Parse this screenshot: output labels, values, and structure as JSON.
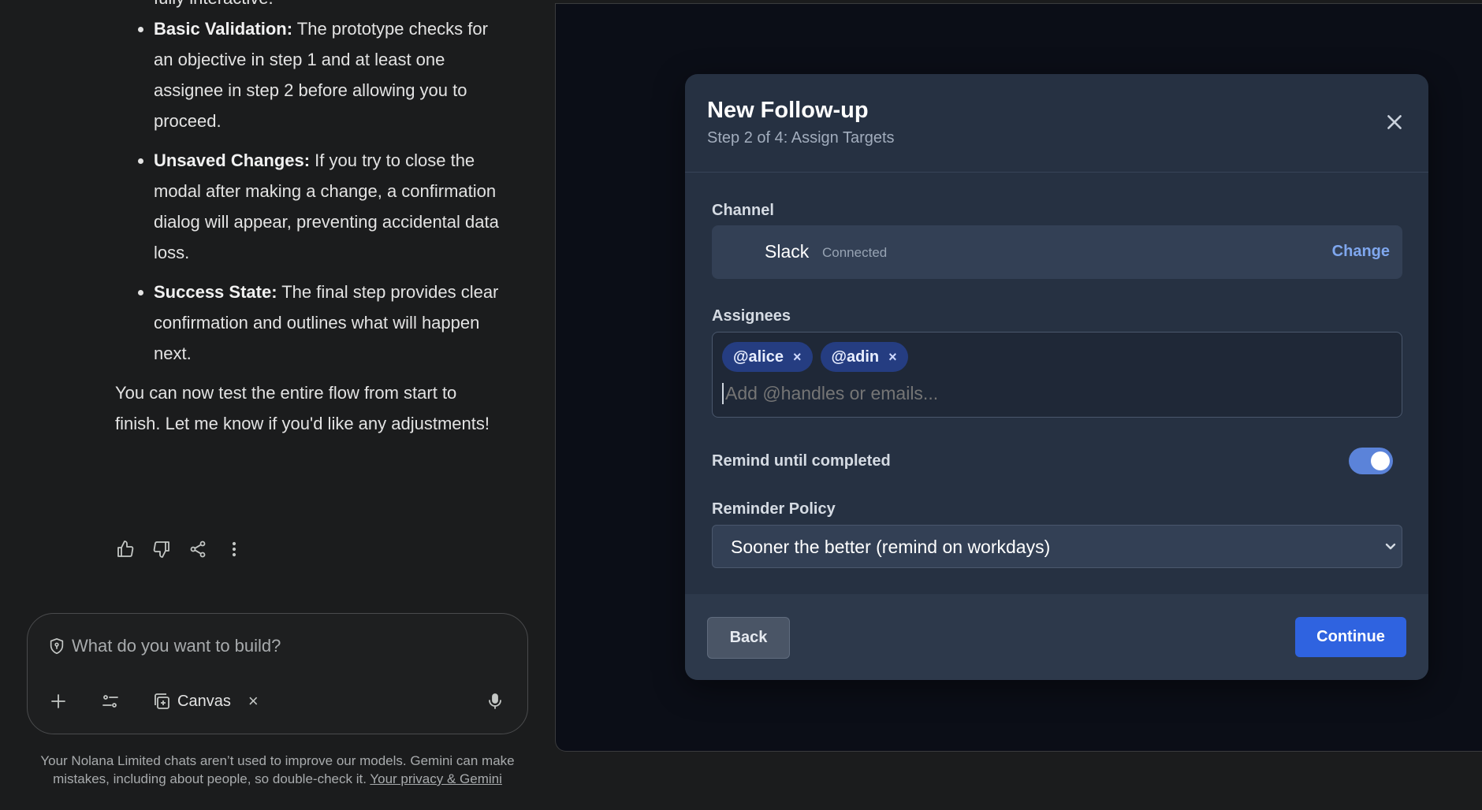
{
  "chat": {
    "partial_first_line": "fully interactive.",
    "bullets": [
      {
        "title": "Basic Validation:",
        "text": " The prototype checks for an objective in step 1 and at least one assignee in step 2 before allowing you to proceed."
      },
      {
        "title": "Unsaved Changes:",
        "text": " If you try to close the modal after making a change, a confirmation dialog will appear, preventing accidental data loss."
      },
      {
        "title": "Success State:",
        "text": " The final step provides clear confirmation and outlines what will happen next."
      }
    ],
    "closing": "You can now test the entire flow from start to finish. Let me know if you'd like any adjustments!",
    "actions": [
      "thumbs-up-icon",
      "thumbs-down-icon",
      "share-icon",
      "more-vert-icon"
    ]
  },
  "composer": {
    "placeholder": "What do you want to build?",
    "canvas_label": "Canvas",
    "canvas_close": "×"
  },
  "disclaimer": {
    "text": "Your Nolana Limited chats aren’t used to improve our models. Gemini can make mistakes, including about people, so double-check it. ",
    "link": "Your privacy & Gemini"
  },
  "modal": {
    "title": "New Follow-up",
    "subtitle": "Step 2 of 4: Assign Targets",
    "channel_label": "Channel",
    "channel_name": "Slack",
    "channel_status": "Connected",
    "channel_change": "Change",
    "assignees_label": "Assignees",
    "assignees": [
      "@alice",
      "@adin"
    ],
    "chip_remove": "×",
    "assignees_placeholder": "Add @handles or emails...",
    "remind_label": "Remind until completed",
    "remind_on": true,
    "policy_label": "Reminder Policy",
    "policy_value": "Sooner the better (remind on workdays)",
    "back": "Back",
    "continue": "Continue"
  },
  "colors": {
    "modal_bg": "#263142",
    "accent": "#2f63e0",
    "chip_bg": "#253d81",
    "toggle_on": "#5b83d9"
  }
}
